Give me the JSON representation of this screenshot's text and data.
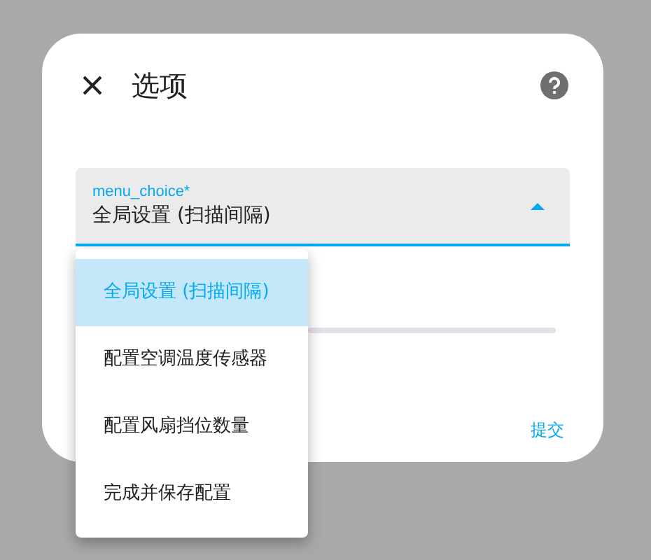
{
  "dialog": {
    "title": "选项",
    "submit_label": "提交"
  },
  "field": {
    "label": "menu_choice*",
    "value": "全局设置 (扫描间隔)",
    "expanded": true
  },
  "menu": {
    "items": [
      {
        "label": "全局设置 (扫描间隔)",
        "selected": true
      },
      {
        "label": "配置空调温度传感器",
        "selected": false
      },
      {
        "label": "配置风扇挡位数量",
        "selected": false
      },
      {
        "label": "完成并保存配置",
        "selected": false
      }
    ]
  }
}
